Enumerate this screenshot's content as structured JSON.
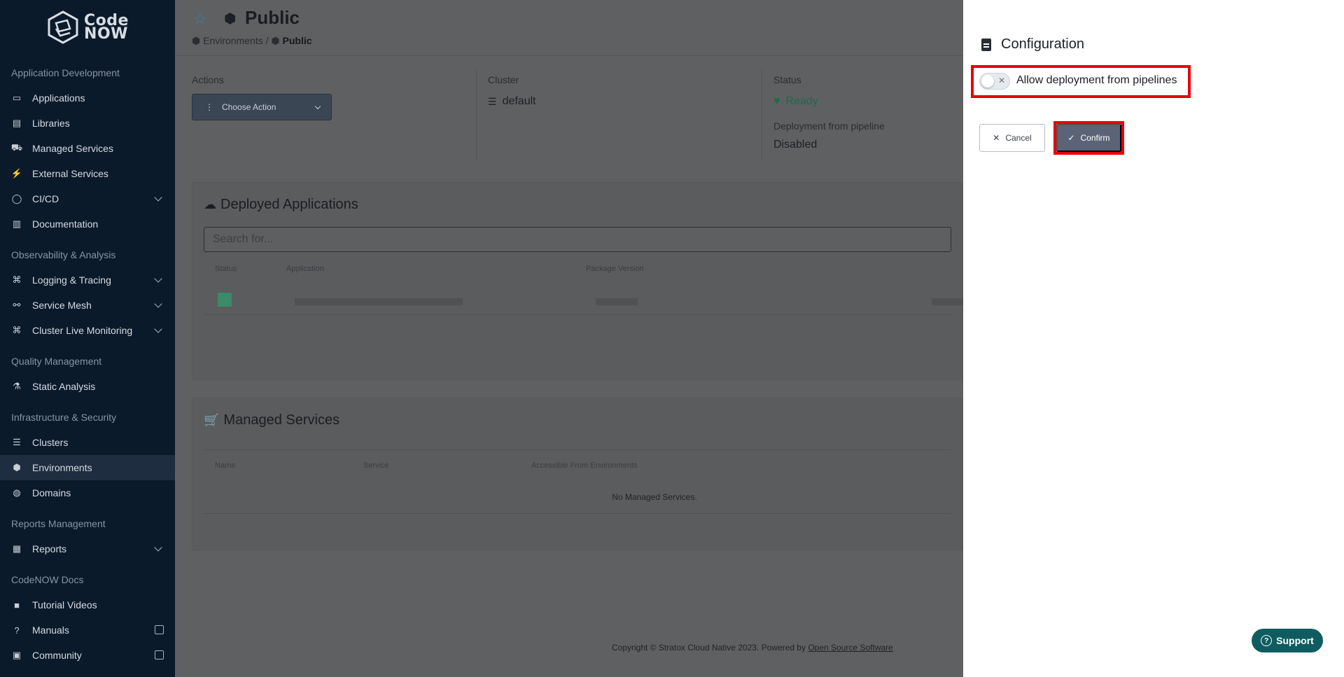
{
  "brand": {
    "line1": "Code",
    "line2": "NOW"
  },
  "sidebar": {
    "sections": [
      {
        "title": "Application Development",
        "items": [
          {
            "label": "Applications",
            "icon": "laptop-icon"
          },
          {
            "label": "Libraries",
            "icon": "book-icon"
          },
          {
            "label": "Managed Services",
            "icon": "cart-icon"
          },
          {
            "label": "External Services",
            "icon": "plug-icon"
          },
          {
            "label": "CI/CD",
            "icon": "cycle-icon",
            "expandable": true
          },
          {
            "label": "Documentation",
            "icon": "open-book-icon"
          }
        ]
      },
      {
        "title": "Observability & Analysis",
        "items": [
          {
            "label": "Logging & Tracing",
            "icon": "binoculars-icon",
            "expandable": true
          },
          {
            "label": "Service Mesh",
            "icon": "mesh-icon",
            "expandable": true
          },
          {
            "label": "Cluster Live Monitoring",
            "icon": "binoculars-icon",
            "expandable": true
          }
        ]
      },
      {
        "title": "Quality Management",
        "items": [
          {
            "label": "Static Analysis",
            "icon": "flask-icon"
          }
        ]
      },
      {
        "title": "Infrastructure & Security",
        "items": [
          {
            "label": "Clusters",
            "icon": "list-icon"
          },
          {
            "label": "Environments",
            "icon": "cube-icon",
            "active": true
          },
          {
            "label": "Domains",
            "icon": "globe-icon"
          }
        ]
      },
      {
        "title": "Reports Management",
        "items": [
          {
            "label": "Reports",
            "icon": "report-icon",
            "expandable": true
          }
        ]
      },
      {
        "title": "CodeNOW Docs",
        "items": [
          {
            "label": "Tutorial Videos",
            "icon": "video-icon"
          },
          {
            "label": "Manuals",
            "icon": "help-icon",
            "external": true
          },
          {
            "label": "Community",
            "icon": "chat-icon",
            "external": true
          }
        ]
      }
    ]
  },
  "header": {
    "title": "Public",
    "breadcrumb": {
      "parent": "Environments",
      "separator": "/",
      "current": "Public"
    }
  },
  "info": {
    "actions_label": "Actions",
    "choose_action": "Choose Action",
    "cluster_label": "Cluster",
    "cluster_value": "default",
    "status_label": "Status",
    "status_value": "Ready",
    "deploy_label": "Deployment from pipeline",
    "deploy_value": "Disabled"
  },
  "deployed": {
    "title": "Deployed Applications",
    "search_placeholder": "Search for...",
    "columns": [
      "Status",
      "Application",
      "Package Version"
    ]
  },
  "managed": {
    "title": "Managed Services",
    "columns": [
      "Name",
      "Service",
      "Accessible From Environments"
    ],
    "empty": "No Managed Services."
  },
  "footer": {
    "text": "Copyright © Stratox Cloud Native 2023. Powered by ",
    "link": "Open Source Software"
  },
  "panel": {
    "title": "Configuration",
    "toggle_label": "Allow deployment from pipelines",
    "toggle_on": false,
    "cancel": "Cancel",
    "confirm": "Confirm"
  },
  "support": "Support",
  "colors": {
    "sidebar_bg": "#0b1a2b",
    "highlight": "#e8000b",
    "confirm_bg": "#5b6476",
    "support_bg": "#0f5c60",
    "ready": "#1b6b4a"
  }
}
